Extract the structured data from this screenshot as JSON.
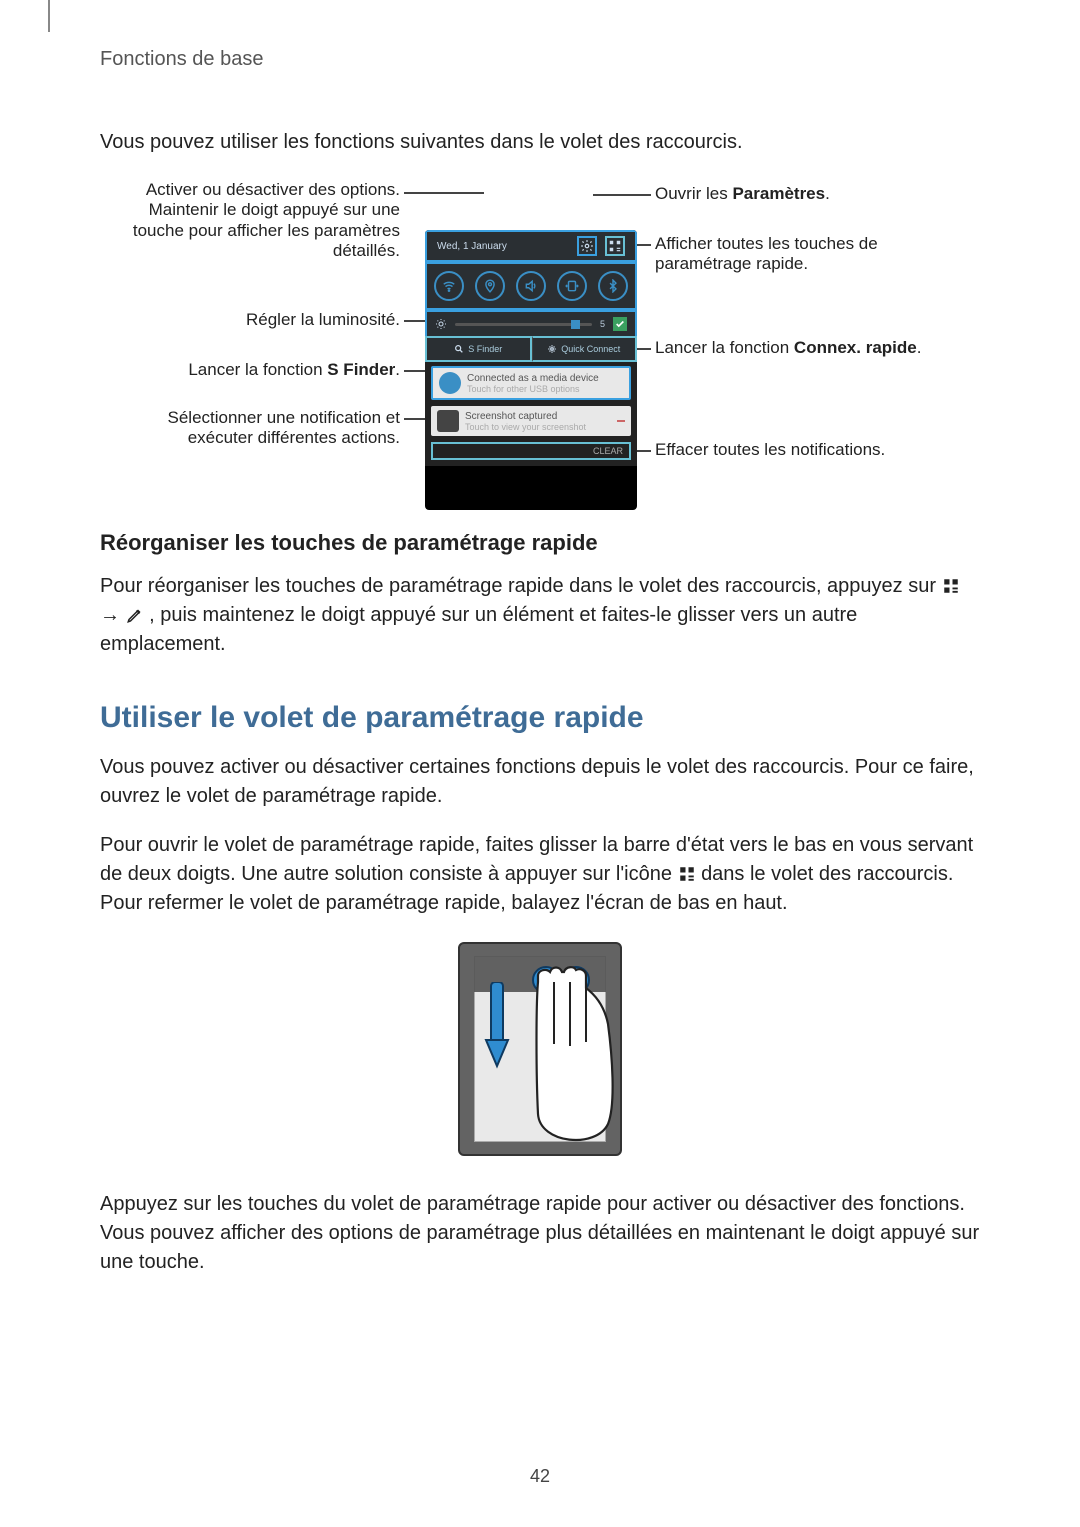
{
  "breadcrumb": "Fonctions de base",
  "intro": "Vous pouvez utiliser les fonctions suivantes dans le volet des raccourcis.",
  "callouts": {
    "left1": "Activer ou désactiver des options. Maintenir le doigt appuyé sur une touche pour afficher les paramètres détaillés.",
    "left2": "Régler la luminosité.",
    "left3_pre": "Lancer la fonction ",
    "left3_bold": "S Finder",
    "left3_post": ".",
    "left4": "Sélectionner une notification et exécuter différentes actions.",
    "right1_pre": "Ouvrir les ",
    "right1_bold": "Paramètres",
    "right1_post": ".",
    "right2": "Afficher toutes les touches de paramétrage rapide.",
    "right3_pre": "Lancer la fonction ",
    "right3_bold": "Connex. rapide",
    "right3_post": ".",
    "right4": "Effacer toutes les notifications."
  },
  "phone": {
    "date": "Wed, 1 January",
    "toggles": [
      "Wi-Fi",
      "Location",
      "Sound",
      "Screen",
      "Bluetooth"
    ],
    "brightness_value": "5",
    "sfinder": "S Finder",
    "quickconnect": "Quick Connect",
    "notif1_title": "Connected as a media device",
    "notif1_sub": "Touch for other USB options",
    "notif2_title": "Screenshot captured",
    "notif2_sub": "Touch to view your screenshot",
    "clear": "CLEAR"
  },
  "subheading": "Réorganiser les touches de paramétrage rapide",
  "reorg_para_pre": "Pour réorganiser les touches de paramétrage rapide dans le volet des raccourcis, appuyez sur ",
  "reorg_para_arrow": " → ",
  "reorg_para_post": ", puis maintenez le doigt appuyé sur un élément et faites-le glisser vers un autre emplacement.",
  "section_heading": "Utiliser le volet de paramétrage rapide",
  "sect_para1": "Vous pouvez activer ou désactiver certaines fonctions depuis le volet des raccourcis. Pour ce faire, ouvrez le volet de paramétrage rapide.",
  "sect_para2_pre": "Pour ouvrir le volet de paramétrage rapide, faites glisser la barre d'état vers le bas en vous servant de deux doigts. Une autre solution consiste à appuyer sur l'icône ",
  "sect_para2_post": " dans le volet des raccourcis. Pour refermer le volet de paramétrage rapide, balayez l'écran de bas en haut.",
  "sect_para3": "Appuyez sur les touches du volet de paramétrage rapide pour activer ou désactiver des fonctions. Vous pouvez afficher des options de paramétrage plus détaillées en maintenant le doigt appuyé sur une touche.",
  "page_number": "42"
}
